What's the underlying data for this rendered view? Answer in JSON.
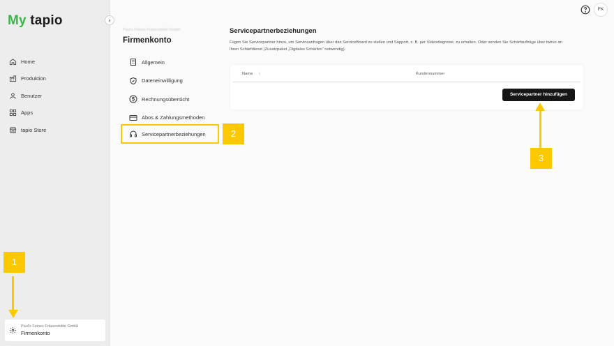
{
  "app": {
    "logo_my": "My",
    "logo_tapio": "tapio"
  },
  "sidebar": {
    "collapse_icon": "chevron-left-icon",
    "items": [
      {
        "label": "Home",
        "icon": "home-icon"
      },
      {
        "label": "Produktion",
        "icon": "factory-icon"
      },
      {
        "label": "Benutzer",
        "icon": "user-icon"
      },
      {
        "label": "Apps",
        "icon": "apps-icon"
      },
      {
        "label": "tapio Store",
        "icon": "store-icon"
      }
    ],
    "company": {
      "name": "Paul's Feines Fräserstüble GmbH",
      "label": "Firmenkonto",
      "icon": "gear-icon"
    }
  },
  "header": {
    "avatar_initials": "FK",
    "help_icon": "help-icon"
  },
  "account": {
    "breadcrumb_blurred": "Paul's Feines Fräserstüble GmbH",
    "title": "Firmenkonto",
    "nav": [
      {
        "label": "Allgemein",
        "icon": "building-icon"
      },
      {
        "label": "Dateneinwilligung",
        "icon": "shield-check-icon"
      },
      {
        "label": "Rechnungsübersicht",
        "icon": "dollar-icon"
      },
      {
        "label": "Abos & Zahlungsmethoden",
        "icon": "credit-card-icon"
      },
      {
        "label": "Servicepartnerbeziehungen",
        "icon": "headset-icon",
        "active": true
      }
    ]
  },
  "content": {
    "title": "Servicepartnerbeziehungen",
    "description": "Fügen Sie Servicepartner hinzu, um Serviceanfragen über das ServiceBoard zu stellen und Support, z. B. per Videodiagnose, zu erhalten. Oder senden Sie Schärfaufträge über twinio an Ihren Schärfdienst (Zusatzpaket „Digitales Schärfen“ notwendig).",
    "table": {
      "col_name": "Name",
      "sort_icon": "↑",
      "col_customer": "Kundennummer"
    },
    "add_button": "Servicepartner hinzufügen"
  },
  "annotations": {
    "badge1": "1",
    "badge2": "2",
    "badge3": "3",
    "color": "#fcc800"
  }
}
